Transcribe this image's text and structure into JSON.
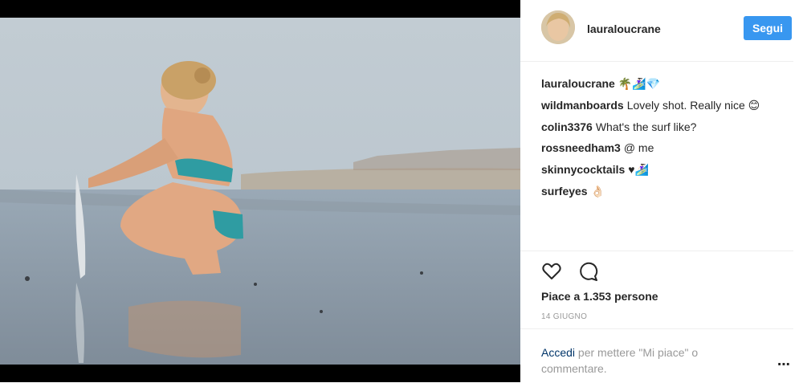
{
  "post": {
    "image_alt": "woman crouching with surfboard on beach"
  },
  "header": {
    "username": "lauraloucrane",
    "follow_label": "Segui"
  },
  "comments": [
    {
      "user": "lauraloucrane",
      "text": "🌴🏄🏻‍♀️💎"
    },
    {
      "user": "wildmanboards",
      "text": "Lovely shot. Really nice 😊"
    },
    {
      "user": "colin3376",
      "text": "What's the surf like?"
    },
    {
      "user": "rossneedham3",
      "text": "@ me"
    },
    {
      "user": "skinnycocktails",
      "text": "♥🏄🏻‍♀️"
    },
    {
      "user": "surfeyes",
      "text": "👌🏻"
    }
  ],
  "actions": {
    "like_icon": "heart-icon",
    "comment_icon": "comment-bubble-icon",
    "likes_text": "Piace a 1.353 persone",
    "date": "14 GIUGNO"
  },
  "login": {
    "link": "Accedi",
    "rest": " per mettere \"Mi piace\" o commentare."
  },
  "more_icon": "⋯",
  "colors": {
    "follow_button": "#3897f0",
    "text": "#262626",
    "muted": "#999999",
    "link": "#003569"
  }
}
